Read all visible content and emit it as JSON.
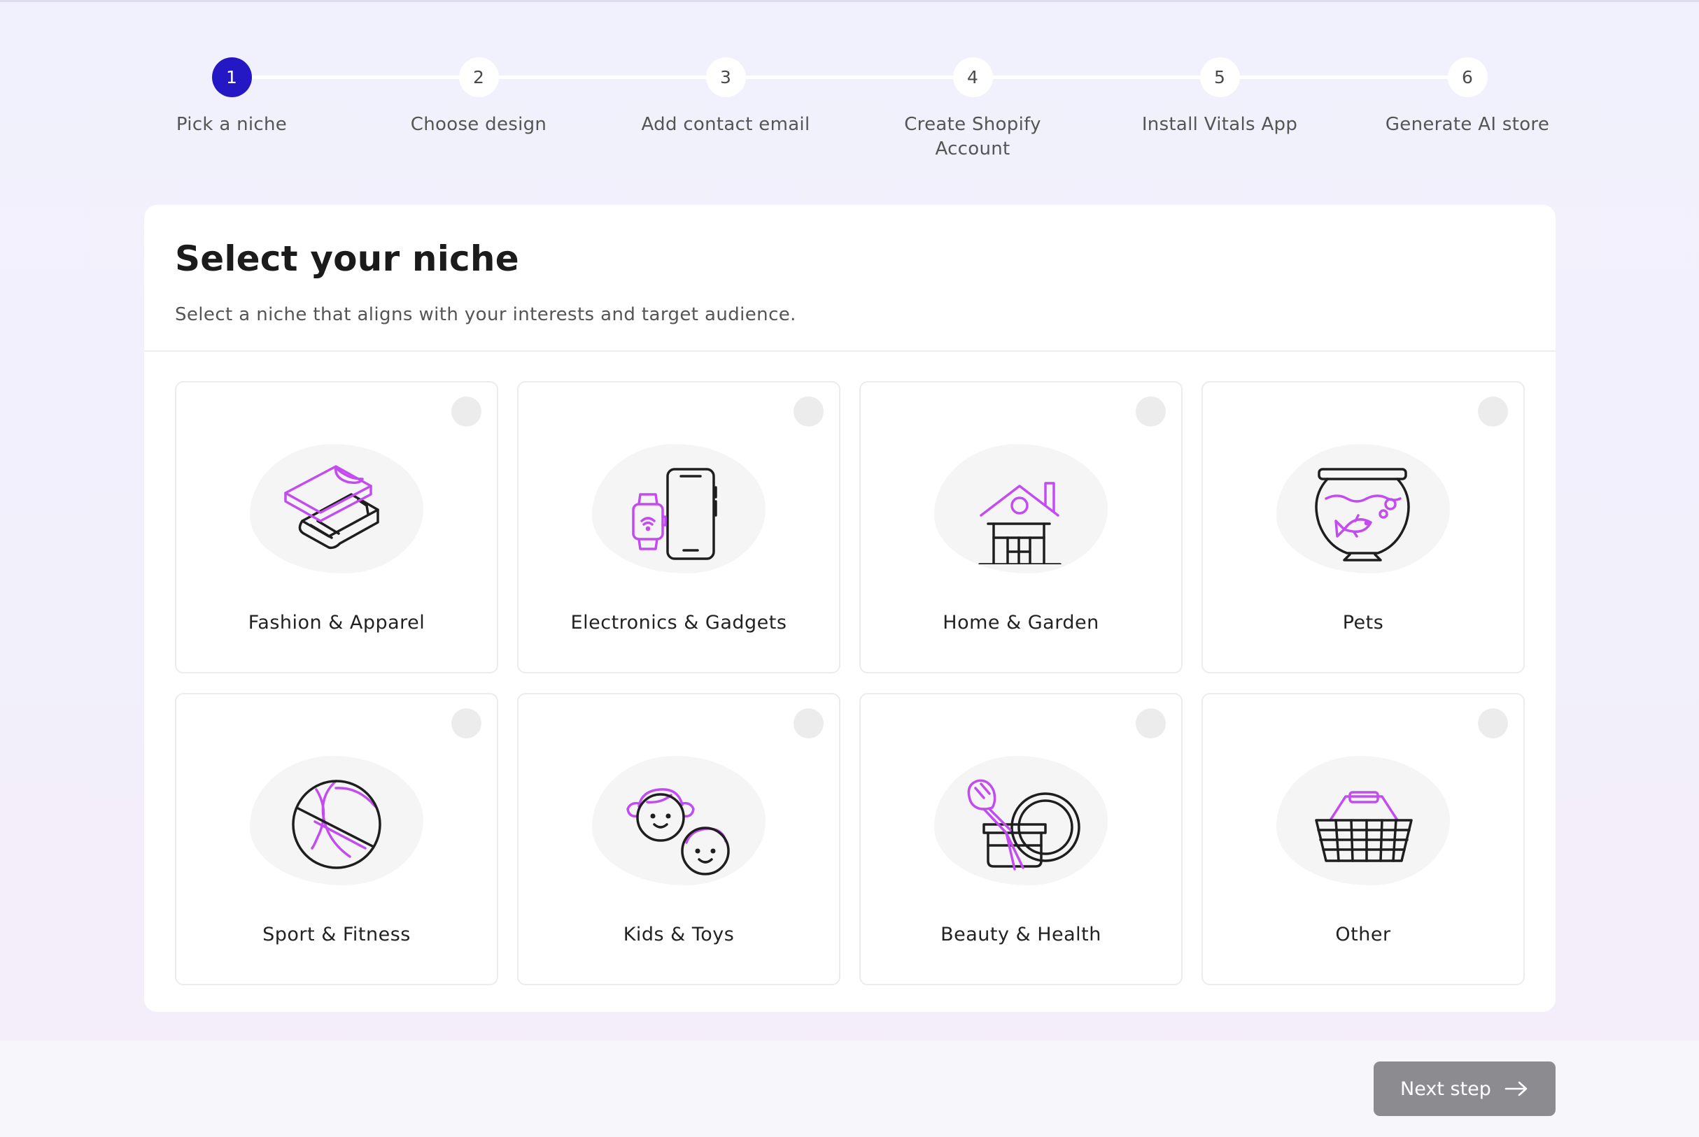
{
  "stepper": {
    "steps": [
      {
        "number": "1",
        "label": "Pick a niche",
        "active": true
      },
      {
        "number": "2",
        "label": "Choose design"
      },
      {
        "number": "3",
        "label": "Add contact email"
      },
      {
        "number": "4",
        "label": "Create Shopify Account"
      },
      {
        "number": "5",
        "label": "Install Vitals App"
      },
      {
        "number": "6",
        "label": "Generate AI store"
      }
    ]
  },
  "niche": {
    "title": "Select your niche",
    "subtitle": "Select a niche that aligns with your interests and target audience.",
    "options": [
      {
        "label": "Fashion & Apparel",
        "icon": "clothing-icon"
      },
      {
        "label": "Electronics & Gadgets",
        "icon": "smartphone-watch-icon"
      },
      {
        "label": "Home & Garden",
        "icon": "house-icon"
      },
      {
        "label": "Pets",
        "icon": "fishbowl-icon"
      },
      {
        "label": "Sport & Fitness",
        "icon": "ball-icon"
      },
      {
        "label": "Kids & Toys",
        "icon": "kids-faces-icon"
      },
      {
        "label": "Beauty & Health",
        "icon": "cosmetics-icon"
      },
      {
        "label": "Other",
        "icon": "basket-icon"
      }
    ]
  },
  "footer": {
    "next_label": "Next step",
    "next_icon": "arrow-right-icon"
  },
  "colors": {
    "accent": "#2318c4",
    "icon_magenta": "#c34cf0",
    "button_disabled": "#8c8c90"
  }
}
